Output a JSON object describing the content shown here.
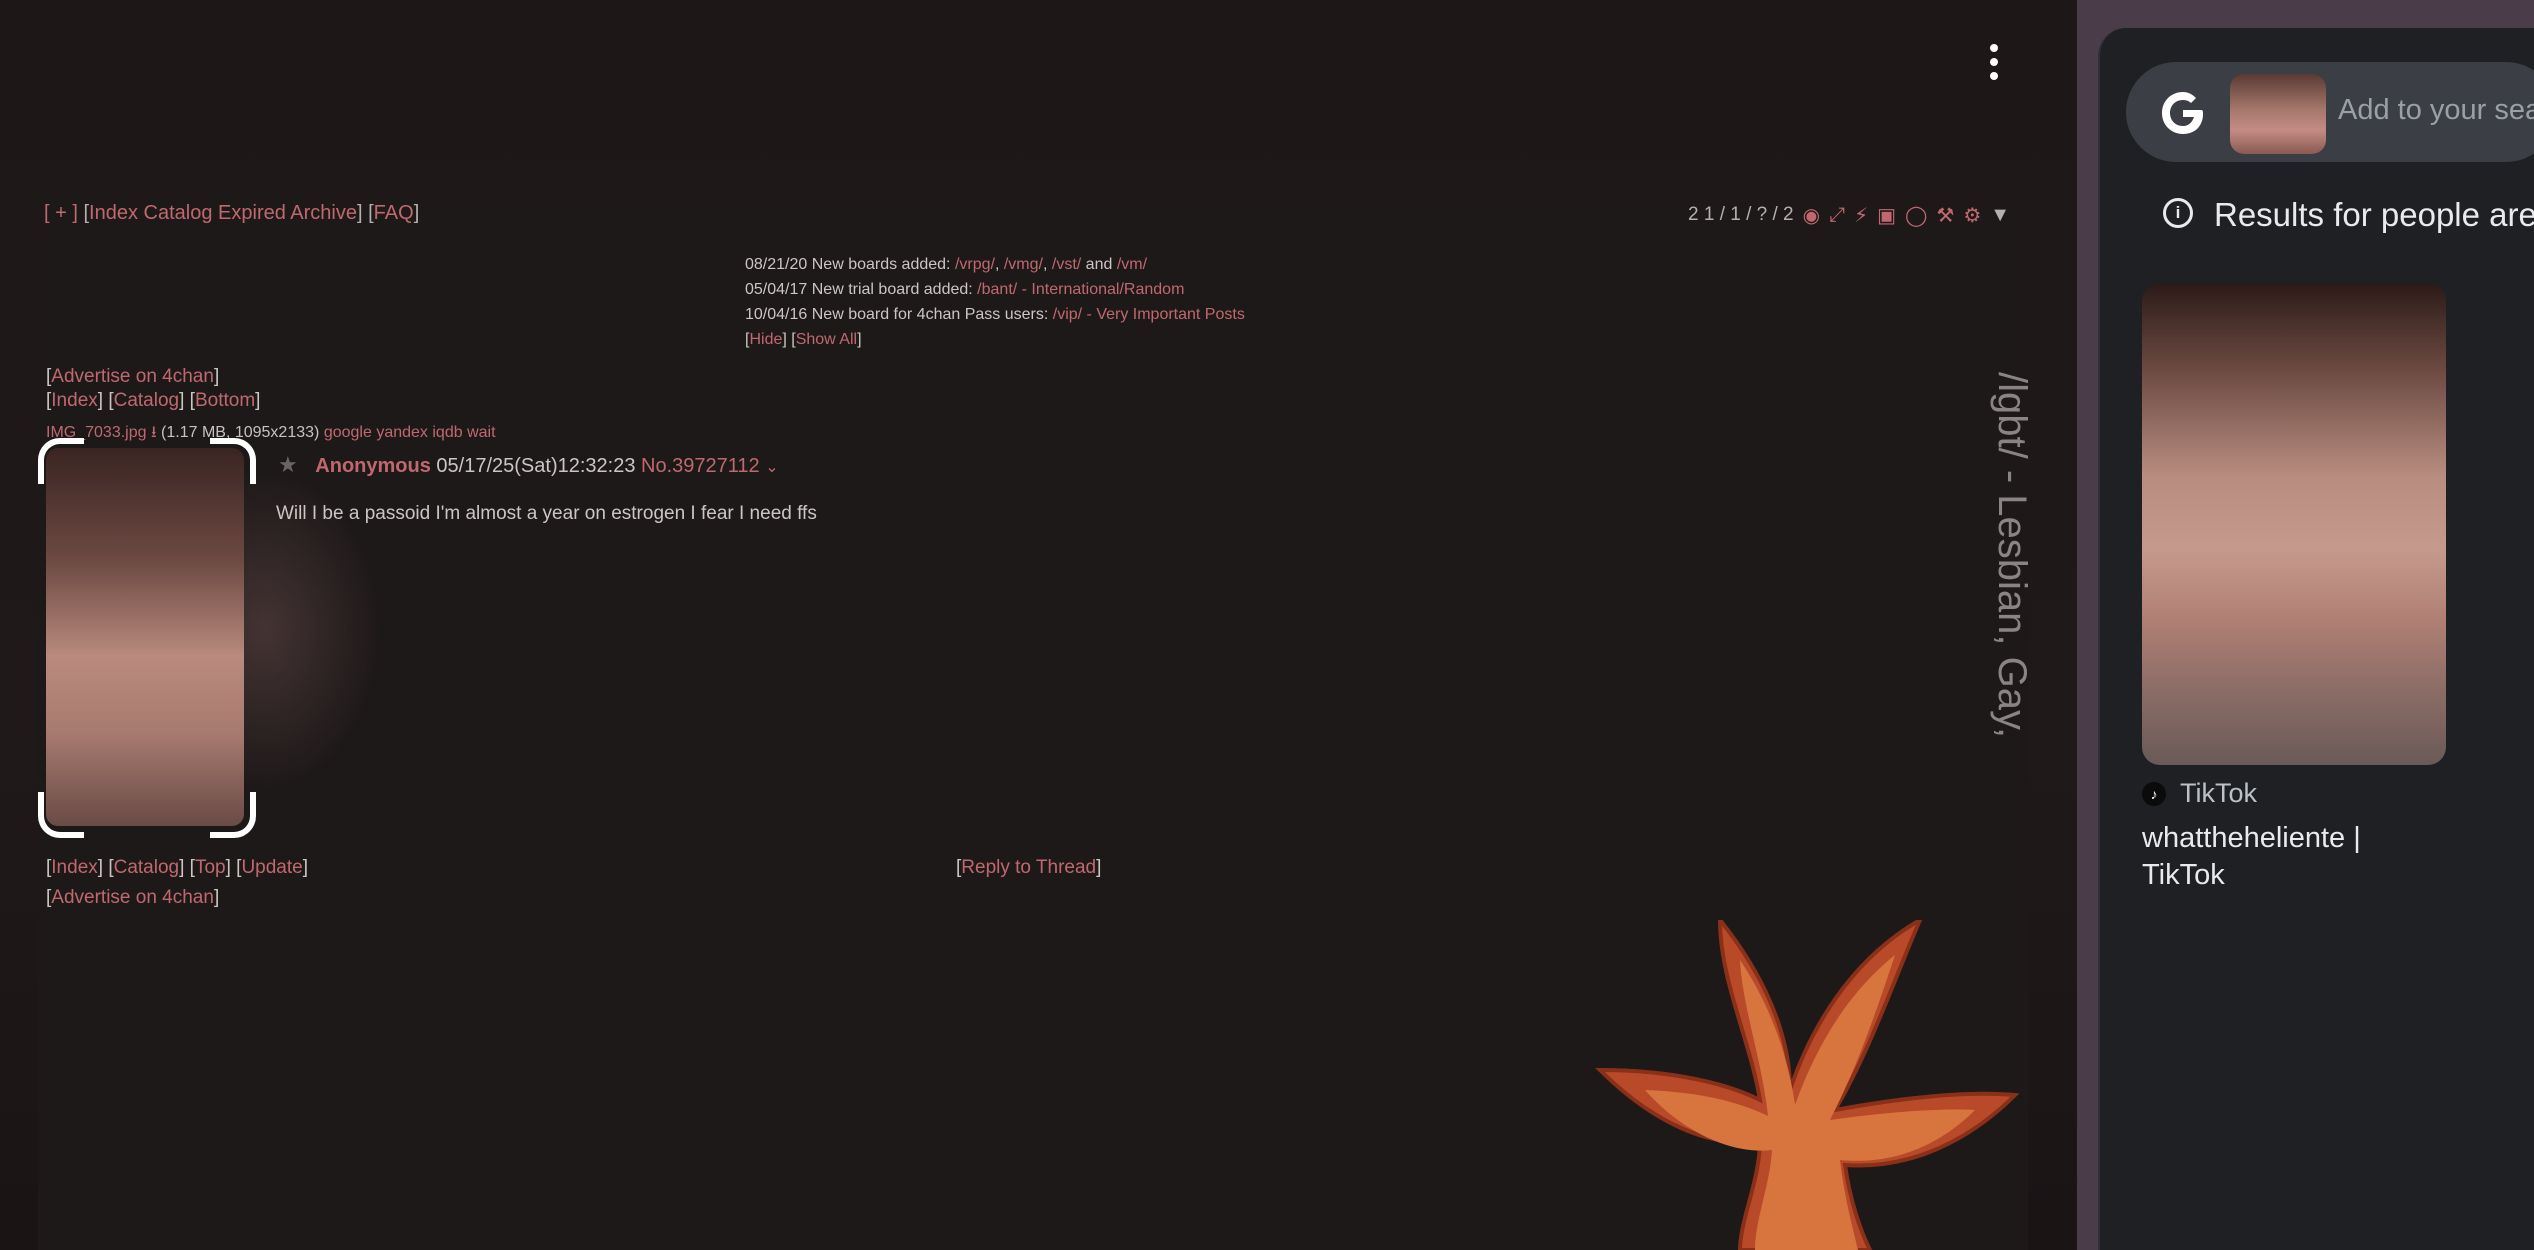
{
  "nav": {
    "plus": "[ + ]",
    "index": "Index",
    "catalog": "Catalog",
    "expired": "Expired",
    "archive": "Archive",
    "faq": "FAQ"
  },
  "toolbar": {
    "counts": "2 1 / 1 / ? / 2"
  },
  "news": [
    {
      "date": "08/21/20",
      "text": "New boards added:",
      "links": [
        "/vrpg/",
        "/vmg/",
        "/vst/"
      ],
      "and": "and",
      "last": "/vm/"
    },
    {
      "date": "05/04/17",
      "text": "New trial board added:",
      "link": "/bant/ - International/Random"
    },
    {
      "date": "10/04/16",
      "text": "New board for 4chan Pass users:",
      "link": "/vip/ - Very Important Posts"
    }
  ],
  "news_controls": {
    "hide": "Hide",
    "show_all": "Show All"
  },
  "advertise": "Advertise on 4chan",
  "top_nav": {
    "index": "Index",
    "catalog": "Catalog",
    "bottom": "Bottom"
  },
  "file": {
    "name": "IMG_7033.jpg",
    "info": "(1.17 MB, 1095x2133)",
    "search": [
      "google",
      "yandex",
      "iqdb",
      "wait"
    ]
  },
  "post": {
    "name": "Anonymous",
    "datetime": "05/17/25(Sat)12:32:23",
    "number": "No.39727112",
    "message": "Will I be a passoid I'm almost a year on estrogen I fear I need ffs"
  },
  "bottom_nav": {
    "index": "Index",
    "catalog": "Catalog",
    "top": "Top",
    "update": "Update",
    "reply": "Reply to Thread"
  },
  "board_title": "/lgbt/ - Lesbian, Gay,",
  "lens": {
    "search_placeholder": "Add to your sea",
    "results_heading": "Results for people are",
    "result": {
      "source": "TikTok",
      "title": "whattheheliente | TikTok"
    }
  },
  "colors": {
    "link": "#c0686f",
    "text": "#cbc6c3",
    "panel": "#1f2024",
    "accent_leaf": "#c0683a"
  }
}
